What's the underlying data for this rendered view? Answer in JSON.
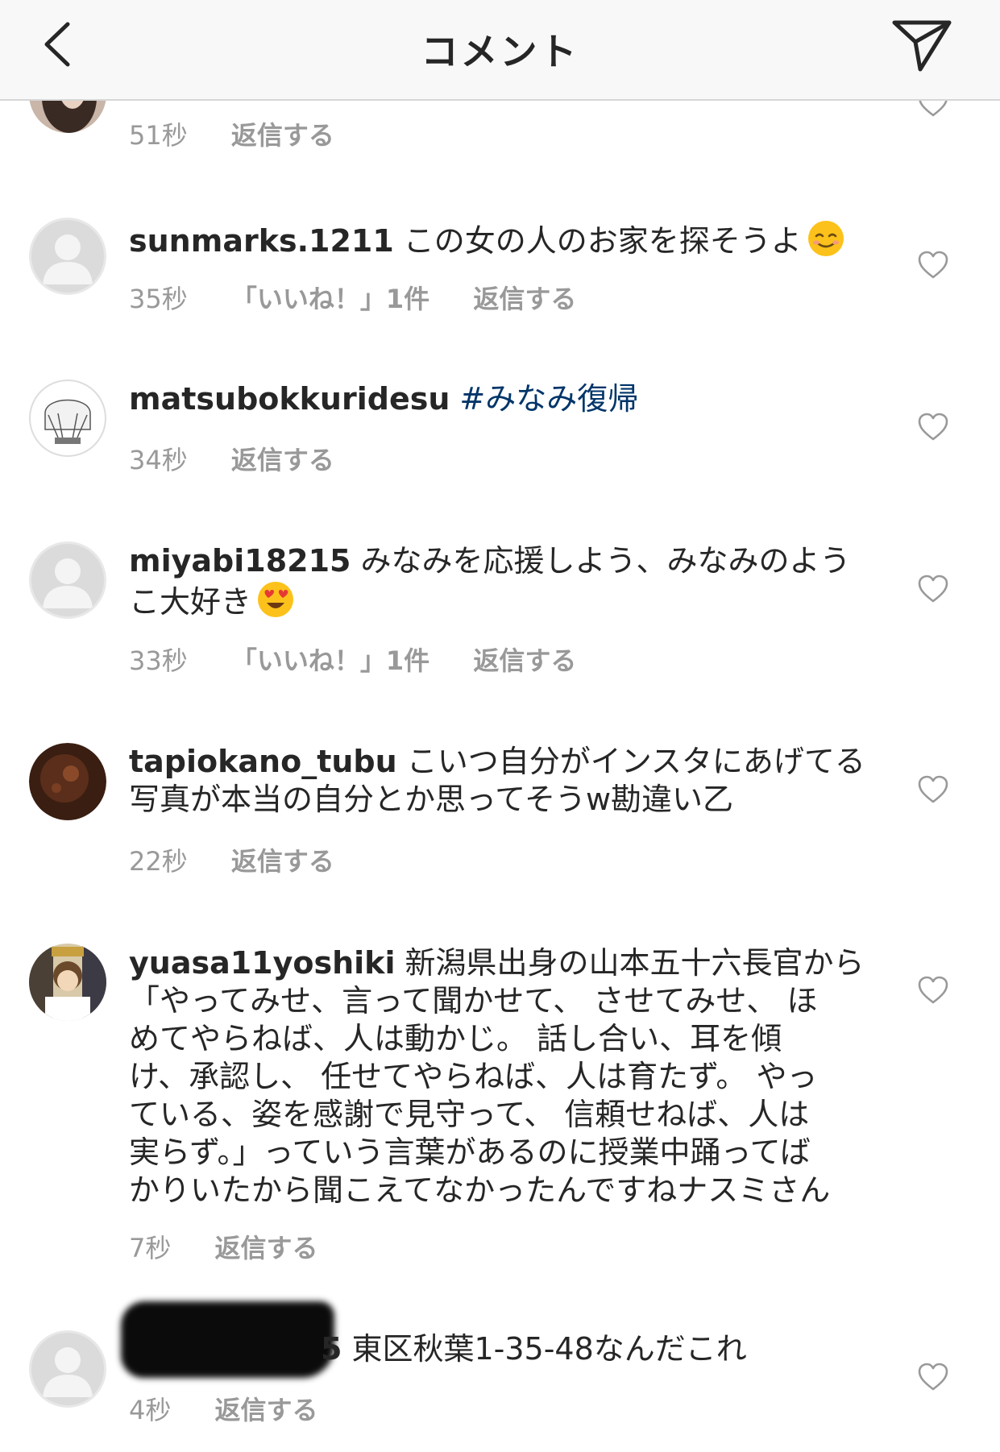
{
  "header": {
    "title": "コメント",
    "back_icon": "chevron-left-icon",
    "send_icon": "paper-plane-icon"
  },
  "comments": [
    {
      "time": "51秒",
      "reply": "返信する"
    },
    {
      "username": "sunmarks.1211",
      "text": "この女の人のお家を探そうよ",
      "emoji": "smiling-face-icon",
      "time": "35秒",
      "likes": "「いいね！」1件",
      "reply": "返信する"
    },
    {
      "username": "matsubokkuridesu",
      "hashtag": "#みなみ復帰",
      "time": "34秒",
      "reply": "返信する"
    },
    {
      "username": "miyabi18215",
      "text_line1": "みなみを応援しよう、みなみのよう",
      "text_line2": "こ大好き",
      "emoji": "heart-eyes-face-icon",
      "time": "33秒",
      "likes": "「いいね！」1件",
      "reply": "返信する"
    },
    {
      "username": "tapiokano_tubu",
      "text_line1": "こいつ自分がインスタにあげてる",
      "text_line2": "写真が本当の自分とか思ってそうw勘違い乙",
      "time": "22秒",
      "reply": "返信する"
    },
    {
      "username": "yuasa11yoshiki",
      "lines": [
        "新潟県出身の山本五十六長官から",
        "「やってみせ、言って聞かせて、 させてみせ、 ほ",
        "めてやらねば、人は動かじ。 話し合い、耳を傾",
        "け、承認し、 任せてやらねば、人は育たず。 やっ",
        "ている、姿を感謝で見守って、 信頼せねば、人は",
        "実らず。」っていう言葉があるのに授業中踊ってば",
        "かりいたから聞こえてなかったんですねナスミさん"
      ],
      "time": "7秒",
      "reply": "返信する"
    },
    {
      "username_visible": "5",
      "text": "東区秋葉1-35-48なんだこれ",
      "time": "4秒",
      "reply": "返信する"
    }
  ],
  "colors": {
    "text": "#262626",
    "meta": "#999999",
    "hashtag": "#003569",
    "header_bg": "#f8f8f8"
  }
}
